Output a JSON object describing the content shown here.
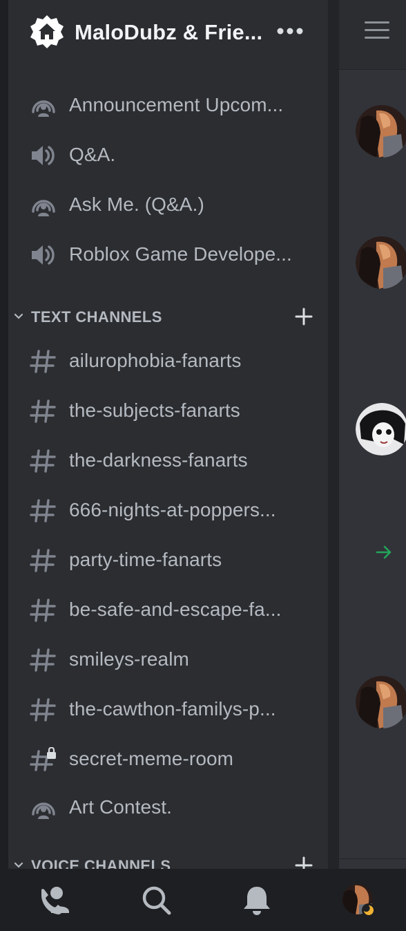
{
  "server": {
    "name": "MaloDubz & Frie...",
    "icon": "home-icon",
    "more_icon": "more-dots-icon"
  },
  "top_channels": [
    {
      "label": "Announcement Upcom...",
      "icon": "stage-icon"
    },
    {
      "label": "Q&A.",
      "icon": "speaker-icon"
    },
    {
      "label": "Ask Me. (Q&A.)",
      "icon": "stage-icon"
    },
    {
      "label": "Roblox Game Develope...",
      "icon": "speaker-icon"
    }
  ],
  "text_category": {
    "label": "TEXT CHANNELS",
    "add_icon": "plus-icon"
  },
  "text_channels": [
    {
      "label": "ailurophobia-fanarts",
      "icon": "hash-icon"
    },
    {
      "label": "the-subjects-fanarts",
      "icon": "hash-icon"
    },
    {
      "label": "the-darkness-fanarts",
      "icon": "hash-icon"
    },
    {
      "label": "666-nights-at-poppers...",
      "icon": "hash-icon"
    },
    {
      "label": "party-time-fanarts",
      "icon": "hash-icon"
    },
    {
      "label": "be-safe-and-escape-fa...",
      "icon": "hash-icon"
    },
    {
      "label": "smileys-realm",
      "icon": "hash-icon"
    },
    {
      "label": "the-cawthon-familys-p...",
      "icon": "hash-icon"
    },
    {
      "label": "secret-meme-room",
      "icon": "hash-lock-icon"
    },
    {
      "label": "Art Contest.",
      "icon": "stage-icon"
    }
  ],
  "voice_category": {
    "label": "VOICE CHANNELS",
    "add_icon": "plus-icon"
  },
  "bottom_nav": [
    "friends-icon",
    "search-icon",
    "notifications-bell-icon",
    "user-avatar"
  ],
  "colors": {
    "background": "#2b2d31",
    "rail": "#1e1f22",
    "text_muted": "#b5bac1",
    "icon": "#80848e",
    "header_text": "#f2f3f5",
    "accent_green": "#23a55a",
    "status_moon": "#f0b232"
  }
}
